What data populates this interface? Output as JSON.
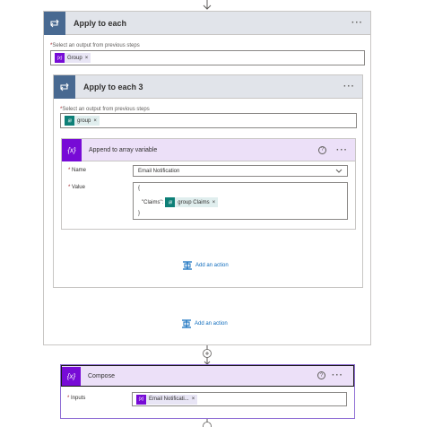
{
  "apply_each_outer": {
    "title": "Apply to each",
    "menu": "···",
    "field_caption": "Select an output from previous steps",
    "token": "Group",
    "token_remove": "×"
  },
  "apply_each_inner": {
    "title": "Apply to each 3",
    "menu": "···",
    "field_caption": "Select an output from previous steps",
    "token": "group",
    "token_remove": "×"
  },
  "append_card": {
    "title": "Append to array variable",
    "help": "?",
    "menu": "···",
    "name_label": "Name",
    "name_value": "Email Notification",
    "value_label": "Value",
    "value_open": "{",
    "value_key": "\"Claims\":",
    "value_token": "group Claims",
    "value_token_remove": "×",
    "value_close": "}"
  },
  "inner_add_action": "Add an action",
  "outer_add_action": "Add an action",
  "compose_card": {
    "title": "Compose",
    "help": "?",
    "menu": "···",
    "inputs_label": "Inputs",
    "token": "Email Notificati...",
    "token_remove": "×"
  },
  "required_mark": "*",
  "icons": {
    "loop": "loop-icon",
    "variable": "variable-icon",
    "dynamic": "dynamic-content-icon",
    "add": "add-action-icon"
  },
  "colors": {
    "loop": "#486991",
    "variable": "#770bd6",
    "dynamic": "#0d7f77",
    "link": "#0f6cbd"
  }
}
